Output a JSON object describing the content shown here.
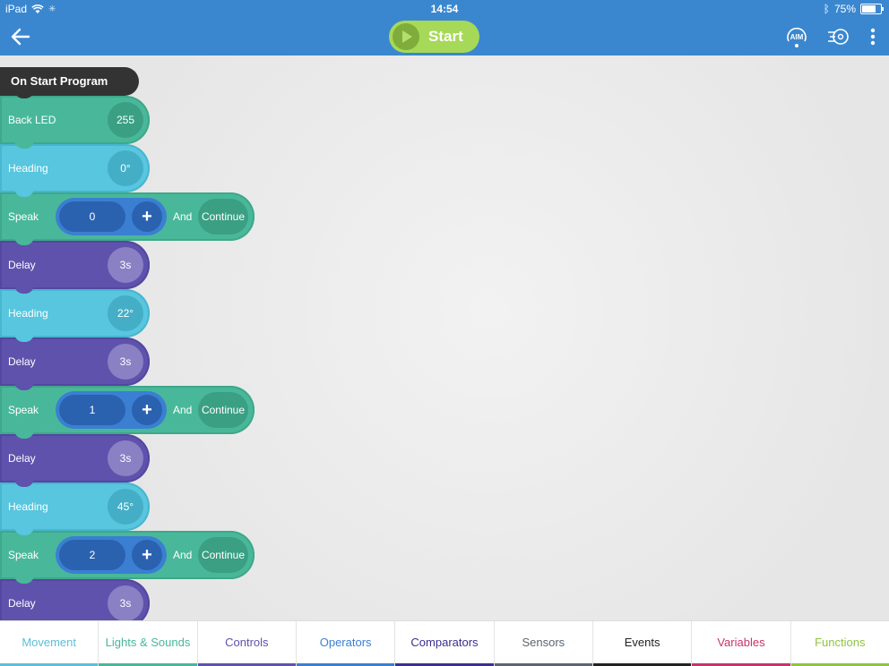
{
  "status": {
    "device": "iPad",
    "time": "14:54",
    "battery": "75%"
  },
  "toolbar": {
    "start_label": "Start",
    "aim_label": "AIM"
  },
  "program": {
    "title": "On Start Program",
    "blocks": [
      {
        "label": "Back LED",
        "value": "255"
      },
      {
        "label": "Heading",
        "value": "0°"
      },
      {
        "label": "Speak",
        "value": "0",
        "plus": "+",
        "and": "And",
        "mode": "Continue"
      },
      {
        "label": "Delay",
        "value": "3s"
      },
      {
        "label": "Heading",
        "value": "22°"
      },
      {
        "label": "Delay",
        "value": "3s"
      },
      {
        "label": "Speak",
        "value": "1",
        "plus": "+",
        "and": "And",
        "mode": "Continue"
      },
      {
        "label": "Delay",
        "value": "3s"
      },
      {
        "label": "Heading",
        "value": "45°"
      },
      {
        "label": "Speak",
        "value": "2",
        "plus": "+",
        "and": "And",
        "mode": "Continue"
      },
      {
        "label": "Delay",
        "value": "3s"
      }
    ]
  },
  "categories": [
    {
      "label": "Movement",
      "color": "#5bbfd6"
    },
    {
      "label": "Lights & Sounds",
      "color": "#48b79a"
    },
    {
      "label": "Controls",
      "color": "#5e52ac"
    },
    {
      "label": "Operators",
      "color": "#3a7fd2"
    },
    {
      "label": "Comparators",
      "color": "#3b2f8f"
    },
    {
      "label": "Sensors",
      "color": "#5b6670"
    },
    {
      "label": "Events",
      "color": "#222222"
    },
    {
      "label": "Variables",
      "color": "#c7336a"
    },
    {
      "label": "Functions",
      "color": "#8cc63f"
    }
  ],
  "colors": {
    "accent": "#3a87d0",
    "start": "#a6d957"
  }
}
